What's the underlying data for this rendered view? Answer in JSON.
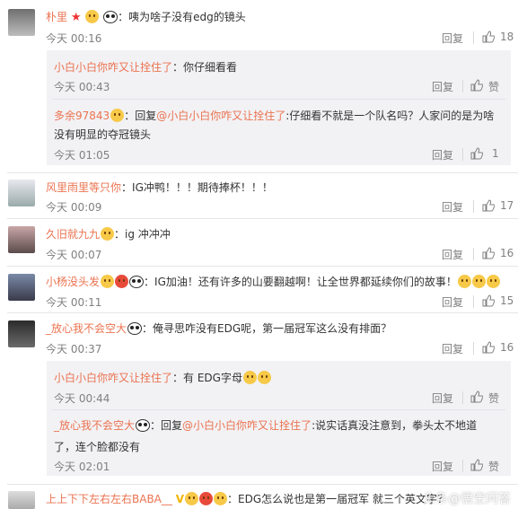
{
  "comments": [
    {
      "name": "朴里",
      "text": "咦为啥子没有edg的镜头",
      "time": "今天 00:16",
      "reply": "回复",
      "likes": "18"
    },
    {
      "name": "小白小白你咋又让拴住了",
      "text": "你仔细看看",
      "time": "今天 00:43",
      "reply": "回复",
      "likes": "赞"
    },
    {
      "name": "多余97843",
      "text_prefix": "回复",
      "mention": "@小白小白你咋又让拴住了",
      "text_line1": ":仔细看不就是一个队名吗？人家问的是为啥",
      "text_line2": "没有明显的夺冠镜头",
      "time": "今天 01:05",
      "reply": "回复",
      "likes": "1"
    },
    {
      "name": "风里雨里等只你",
      "text": "IG冲鸭！！！期待捧杯！！！",
      "time": "今天 00:09",
      "reply": "回复",
      "likes": "17"
    },
    {
      "name": "久旧就九九",
      "text": "ig 冲冲冲",
      "time": "今天 00:07",
      "reply": "回复",
      "likes": "16"
    },
    {
      "name": "小杨没头发",
      "text": "IG加油！还有许多的山要翻越啊！让全世界都延续你们的故事！",
      "time": "今天 00:11",
      "reply": "回复",
      "likes": "15"
    },
    {
      "name": "_放心我不会空大",
      "text": "俺寻思咋没有EDG呢，第一届冠军这么没有排面？",
      "time": "今天 00:37",
      "reply": "回复",
      "likes": "16"
    },
    {
      "name": "小白小白你咋又让拴住了",
      "text": "有 EDG字母",
      "time": "今天 00:44",
      "reply": "回复",
      "likes": "赞"
    },
    {
      "name": "_放心我不会空大",
      "text_prefix": "回复",
      "mention": "@小白小白你咋又让拴住了",
      "text_line1": ":说实话真没注意到，拳头太不地道",
      "text_line2": "了，连个脸都没有",
      "time": "今天 02:01",
      "reply": "回复",
      "likes": "赞"
    },
    {
      "name": "上上下下左右左右BABA__",
      "text": "EDG怎么说也是第一届冠军 就三个英文字？"
    }
  ],
  "watermark": "头条@悟空问答",
  "colors": {
    "name": "#eb7350",
    "text": "#333333",
    "meta": "#808080",
    "reply_bg": "#f2f2f5"
  }
}
